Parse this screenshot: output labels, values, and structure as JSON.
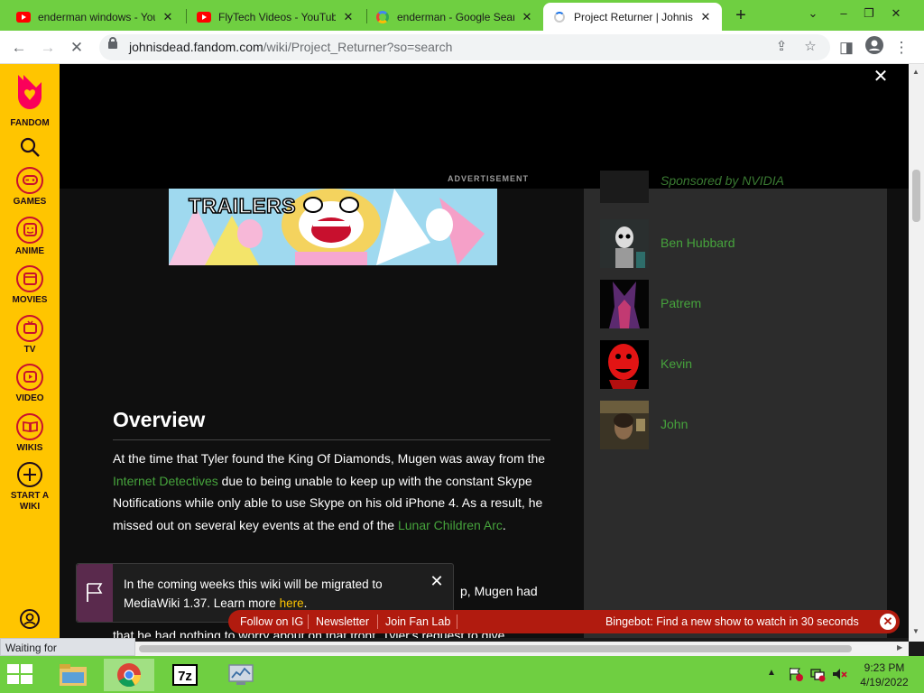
{
  "browser": {
    "tabs": [
      {
        "title": "enderman windows - You",
        "icon": "youtube-icon"
      },
      {
        "title": "FlyTech Videos - YouTube",
        "icon": "youtube-icon"
      },
      {
        "title": "enderman - Google Sear",
        "icon": "google-icon"
      },
      {
        "title": "Project Returner | Johnis",
        "icon": "loading-icon"
      }
    ],
    "url_host": "johnisdead.fandom.com",
    "url_path": "/wiki/Project_Returner?so=search",
    "status_text": "Waiting for cs.media.net..."
  },
  "rail": {
    "logo_label": "FANDOM",
    "items": [
      {
        "label": "GAMES",
        "icon": "gamepad-icon"
      },
      {
        "label": "ANIME",
        "icon": "anime-icon"
      },
      {
        "label": "MOVIES",
        "icon": "clapper-icon"
      },
      {
        "label": "TV",
        "icon": "tv-icon"
      },
      {
        "label": "VIDEO",
        "icon": "play-icon"
      },
      {
        "label": "WIKIS",
        "icon": "book-icon"
      },
      {
        "label": "START A WIKI",
        "icon": "plus-icon"
      }
    ]
  },
  "ad": {
    "label": "ADVERTISEMENT",
    "banner_text": "TRAILERS"
  },
  "article": {
    "heading": "Overview",
    "para1_a": "At the time that Tyler found the King Of Diamonds, Mugen was away from the ",
    "para1_link1": "Internet Detectives",
    "para1_b": " due to being unable to keep up with the constant Skype Notifications while only able to use Skype on his old iPhone 4. As a result, he missed out on several key events at the end of the ",
    "para1_link2": "Lunar Children Arc",
    "para1_c": ".",
    "para2_tail": "p, Mugen had",
    "para2_last": "that he had nothing to worry about on that front. Tyler's request to give"
  },
  "sidebar": {
    "sponsored": "Sponsored by NVIDIA",
    "people": [
      {
        "name": "Ben Hubbard"
      },
      {
        "name": "Patrem"
      },
      {
        "name": "Kevin"
      },
      {
        "name": "John"
      }
    ]
  },
  "notification": {
    "text_a": "In the coming weeks this wiki will be migrated to MediaWiki 1.37. Learn more ",
    "link": "here",
    "text_b": "."
  },
  "bottom_bar": {
    "links": [
      "Follow on IG",
      "Newsletter",
      "Join Fan Lab"
    ],
    "promo": "Bingebot: Find a new show to watch in 30 seconds"
  },
  "taskbar": {
    "time": "9:23 PM",
    "date": "4/19/2022"
  },
  "colors": {
    "fandom_yellow": "#ffc500",
    "link_green": "#46a33c",
    "chrome_green": "#6fcf41",
    "promo_red": "#b11b0f"
  }
}
